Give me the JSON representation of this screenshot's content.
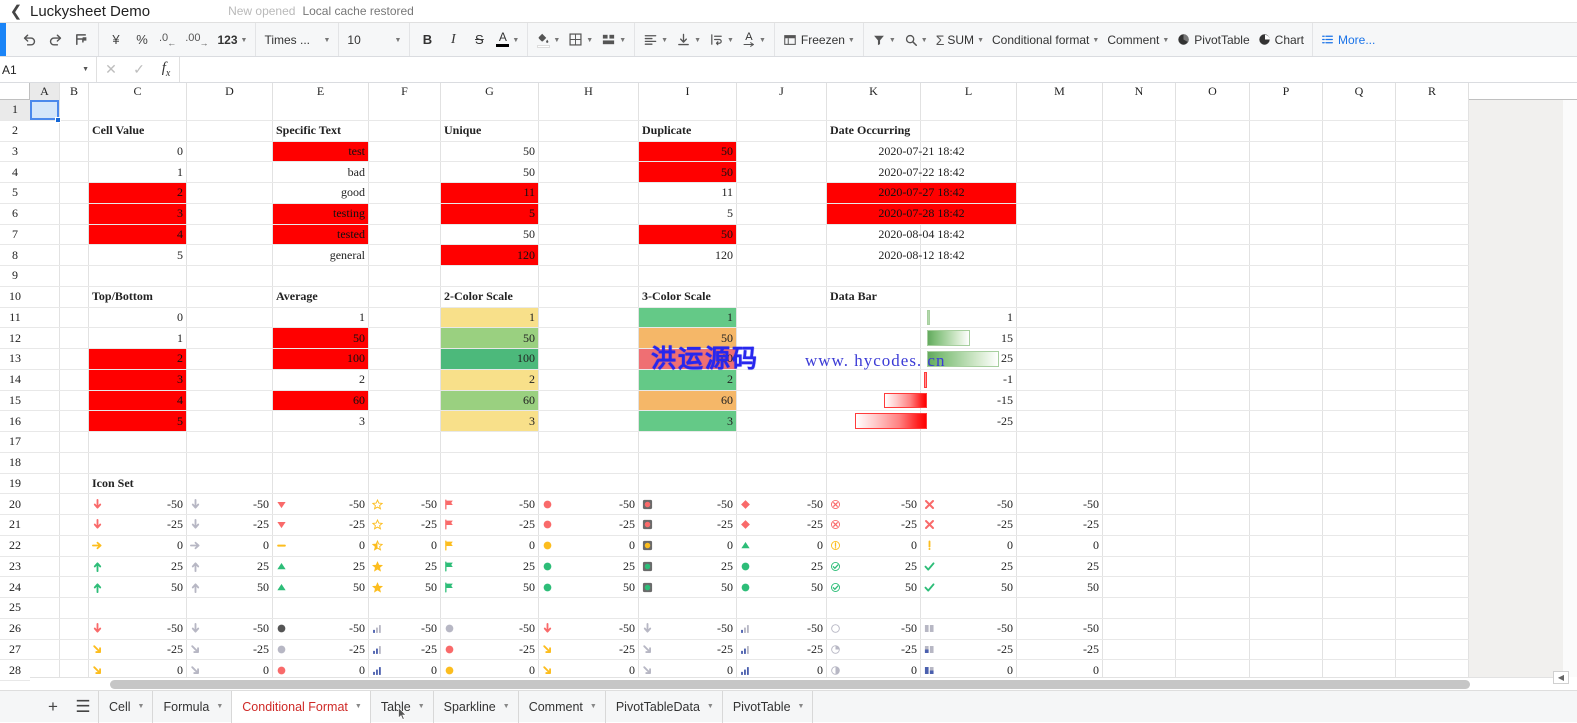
{
  "titlebar": {
    "back_icon": "chevron-left-icon",
    "title": "Luckysheet Demo",
    "status_new": "New opened",
    "status_cache": "Local cache restored"
  },
  "toolbar": {
    "undo": "undo-icon",
    "redo": "redo-icon",
    "format_painter": "format-painter-icon",
    "currency": "¥",
    "percent": "%",
    "decimal_decrease": ".0",
    "decimal_increase": ".00",
    "number_format": "123",
    "font_name": "Times ...",
    "font_size": "10",
    "bold": "B",
    "italic": "I",
    "strikethrough": "S",
    "text_color": "A",
    "fill_color": "fill-color-icon",
    "borders": "borders-icon",
    "merge_cells": "merge-cells-icon",
    "horizontal_align": "align-left-icon",
    "vertical_align": "align-bottom-icon",
    "text_wrap": "text-wrap-icon",
    "text_rotate": "text-rotate-icon",
    "freeze": "Freezen",
    "filter": "filter-icon",
    "find": "search-icon",
    "sum": "SUM",
    "conditional_format": "Conditional format",
    "comment": "Comment",
    "pivot_table": "PivotTable",
    "chart": "Chart",
    "more": "More..."
  },
  "formulabar": {
    "name_box": "A1",
    "cancel": "cancel-icon",
    "confirm": "confirm-icon",
    "fx": "fx",
    "input_value": "",
    "input_placeholder": ""
  },
  "grid": {
    "columns": [
      "A",
      "B",
      "C",
      "D",
      "E",
      "F",
      "G",
      "H",
      "I",
      "J",
      "K",
      "L",
      "M",
      "N",
      "O",
      "P",
      "Q",
      "R"
    ],
    "rows": [
      1,
      2,
      3,
      4,
      5,
      6,
      7,
      8,
      9,
      10,
      11,
      12,
      13,
      14,
      15,
      16,
      17,
      18,
      19,
      20,
      21,
      22,
      23,
      24,
      25,
      26,
      27,
      28
    ],
    "selection": "A1",
    "colors": {
      "red_fill": "#ff0000",
      "scale2_low": "#f8e08a",
      "scale2_mid": "#9ad080",
      "scale2_high": "#4cb97b",
      "scale3_green": "#64c987",
      "scale3_orange": "#f5b768",
      "scale3_red": "#ef6f73",
      "bar_pos": "#63a95e",
      "bar_neg": "#ff0000",
      "icon_red": "#f96a6a",
      "icon_yellow": "#fcbd1e",
      "icon_green": "#2dbd78",
      "icon_gray": "#b7b7c4",
      "icon_blue": "#4a5fae",
      "icon_dark": "#555555"
    },
    "section_headers": {
      "cell_value": "Cell Value",
      "specific_text": "Specific Text",
      "unique": "Unique",
      "duplicate": "Duplicate",
      "date_occurring": "Date Occurring",
      "top_bottom": "Top/Bottom",
      "average": "Average",
      "two_color_scale": "2-Color Scale",
      "three_color_scale": "3-Color Scale",
      "data_bar": "Data Bar",
      "icon_set": "Icon Set"
    },
    "cell_value": {
      "header_cell": "C2",
      "values": [
        "0",
        "1",
        "2",
        "3",
        "4",
        "5"
      ],
      "highlight": [
        false,
        false,
        true,
        true,
        true,
        false
      ]
    },
    "specific_text": {
      "header_cell": "E2",
      "values": [
        "test",
        "bad",
        "good",
        "testing",
        "tested",
        "general"
      ],
      "highlight": [
        true,
        false,
        false,
        true,
        true,
        false
      ]
    },
    "unique": {
      "header_cell": "G2",
      "values": [
        "50",
        "50",
        "11",
        "5",
        "50",
        "120"
      ],
      "highlight": [
        false,
        false,
        true,
        true,
        false,
        true
      ]
    },
    "duplicate": {
      "header_cell": "I2",
      "values": [
        "50",
        "50",
        "11",
        "5",
        "50",
        "120"
      ],
      "highlight": [
        true,
        true,
        false,
        false,
        true,
        false
      ]
    },
    "date_occurring": {
      "header_cell": "K2",
      "values": [
        "2020-07-21 18:42",
        "2020-07-22 18:42",
        "2020-07-27 18:42",
        "2020-07-28 18:42",
        "2020-08-04 18:42",
        "2020-08-12 18:42"
      ],
      "highlight": [
        false,
        false,
        true,
        true,
        false,
        false
      ]
    },
    "top_bottom": {
      "header_cell": "C10",
      "values": [
        "0",
        "1",
        "2",
        "3",
        "4",
        "5"
      ],
      "highlight": [
        false,
        false,
        true,
        true,
        true,
        true
      ]
    },
    "average": {
      "header_cell": "E10",
      "values": [
        "1",
        "50",
        "100",
        "2",
        "60",
        "3"
      ],
      "highlight": [
        false,
        true,
        true,
        false,
        true,
        false
      ]
    },
    "two_color_scale": {
      "header_cell": "G10",
      "values": [
        "1",
        "50",
        "100",
        "2",
        "60",
        "3"
      ],
      "fills": [
        "#f8e08a",
        "#9ad080",
        "#4cb97b",
        "#f8e08a",
        "#9ad080",
        "#f8e08a"
      ]
    },
    "three_color_scale": {
      "header_cell": "I10",
      "values": [
        "1",
        "50",
        "100",
        "2",
        "60",
        "3"
      ],
      "fills": [
        "#64c987",
        "#f5b768",
        "#ef6f73",
        "#64c987",
        "#f5b768",
        "#64c987"
      ]
    },
    "data_bar": {
      "header_cell": "K10",
      "values": [
        1,
        15,
        25,
        -1,
        -15,
        -25
      ],
      "labels": [
        "1",
        "15",
        "25",
        "-1",
        "-15",
        "-25"
      ],
      "max_abs": 25
    },
    "icon_set": {
      "header_cell": "C19",
      "numeric_values": [
        "-50",
        "-25",
        "0",
        "25",
        "50"
      ],
      "block1_sets": [
        {
          "name": "arrow-colored-icon",
          "icons": [
            "arrow-down-red",
            "arrow-down-red",
            "arrow-right-yellow",
            "arrow-up-green",
            "arrow-up-green"
          ]
        },
        {
          "name": "arrow-gray-icon",
          "icons": [
            "arrow-down-gray",
            "arrow-down-gray",
            "arrow-right-gray",
            "arrow-up-gray",
            "arrow-up-gray"
          ]
        },
        {
          "name": "triangle-icon",
          "icons": [
            "triangle-down-red",
            "triangle-down-red",
            "dash-yellow",
            "triangle-up-green",
            "triangle-up-green"
          ]
        },
        {
          "name": "star-icon",
          "icons": [
            "star-empty",
            "star-empty",
            "star-half",
            "star-full",
            "star-full"
          ]
        },
        {
          "name": "flag-icon",
          "icons": [
            "flag-red",
            "flag-red",
            "flag-yellow",
            "flag-green",
            "flag-green"
          ]
        },
        {
          "name": "circle-icon",
          "icons": [
            "circle-red",
            "circle-red",
            "circle-yellow",
            "circle-green",
            "circle-green"
          ]
        },
        {
          "name": "traffic-light-icon",
          "icons": [
            "light-red",
            "light-red",
            "light-yellow",
            "light-green",
            "light-green"
          ]
        },
        {
          "name": "shape-icon",
          "icons": [
            "diamond-red",
            "diamond-red",
            "triangle-up-green",
            "circle-green",
            "circle-green"
          ]
        },
        {
          "name": "symbol-circled-icon",
          "icons": [
            "cross-circled-red",
            "cross-circled-red",
            "exclaim-circled-yellow",
            "check-circled-green",
            "check-circled-green"
          ]
        },
        {
          "name": "symbol-icon",
          "icons": [
            "cross-red",
            "cross-red",
            "exclaim-yellow",
            "check-green",
            "check-green"
          ]
        }
      ],
      "block2_values": [
        "-50",
        "-25",
        "0"
      ],
      "block2_sets": [
        {
          "name": "arrow-3-colored-icon",
          "icons": [
            "arrow-down-red",
            "arrow-downright-yellow",
            "arrow-downright-yellow"
          ]
        },
        {
          "name": "arrow-3-gray-icon",
          "icons": [
            "arrow-down-gray",
            "arrow-downright-gray",
            "arrow-downright-gray"
          ]
        },
        {
          "name": "dot-grayscale-icon",
          "icons": [
            "dot-dark",
            "dot-gray",
            "dot-red"
          ]
        },
        {
          "name": "bars-rating-icon",
          "icons": [
            "bars-1",
            "bars-2",
            "bars-3"
          ]
        },
        {
          "name": "dot-color-icon",
          "icons": [
            "dot-gray",
            "dot-red",
            "dot-yellow"
          ]
        },
        {
          "name": "arrow-colored-icon",
          "icons": [
            "arrow-down-red",
            "arrow-downright-yellow",
            "arrow-downright-yellow"
          ]
        },
        {
          "name": "arrow-gray-icon",
          "icons": [
            "arrow-down-gray",
            "arrow-downright-gray",
            "arrow-downright-gray"
          ]
        },
        {
          "name": "bars-rating-icon",
          "icons": [
            "bars-1",
            "bars-2",
            "bars-3"
          ]
        },
        {
          "name": "pie-progress-icon",
          "icons": [
            "pie-0",
            "pie-25",
            "pie-50"
          ]
        },
        {
          "name": "box-progress-icon",
          "icons": [
            "box-0",
            "box-1",
            "box-2"
          ]
        }
      ]
    },
    "watermark_cn": "洪运源码",
    "watermark_url": "www. hycodes. cn"
  },
  "bottombar": {
    "add_sheet": "add-sheet-icon",
    "sheet_menu": "sheet-list-icon",
    "tabs": [
      {
        "label": "Cell",
        "active": false
      },
      {
        "label": "Formula",
        "active": false
      },
      {
        "label": "Conditional Format",
        "active": true
      },
      {
        "label": "Table",
        "active": false
      },
      {
        "label": "Sparkline",
        "active": false
      },
      {
        "label": "Comment",
        "active": false
      },
      {
        "label": "PivotTableData",
        "active": false
      },
      {
        "label": "PivotTable",
        "active": false
      }
    ]
  }
}
